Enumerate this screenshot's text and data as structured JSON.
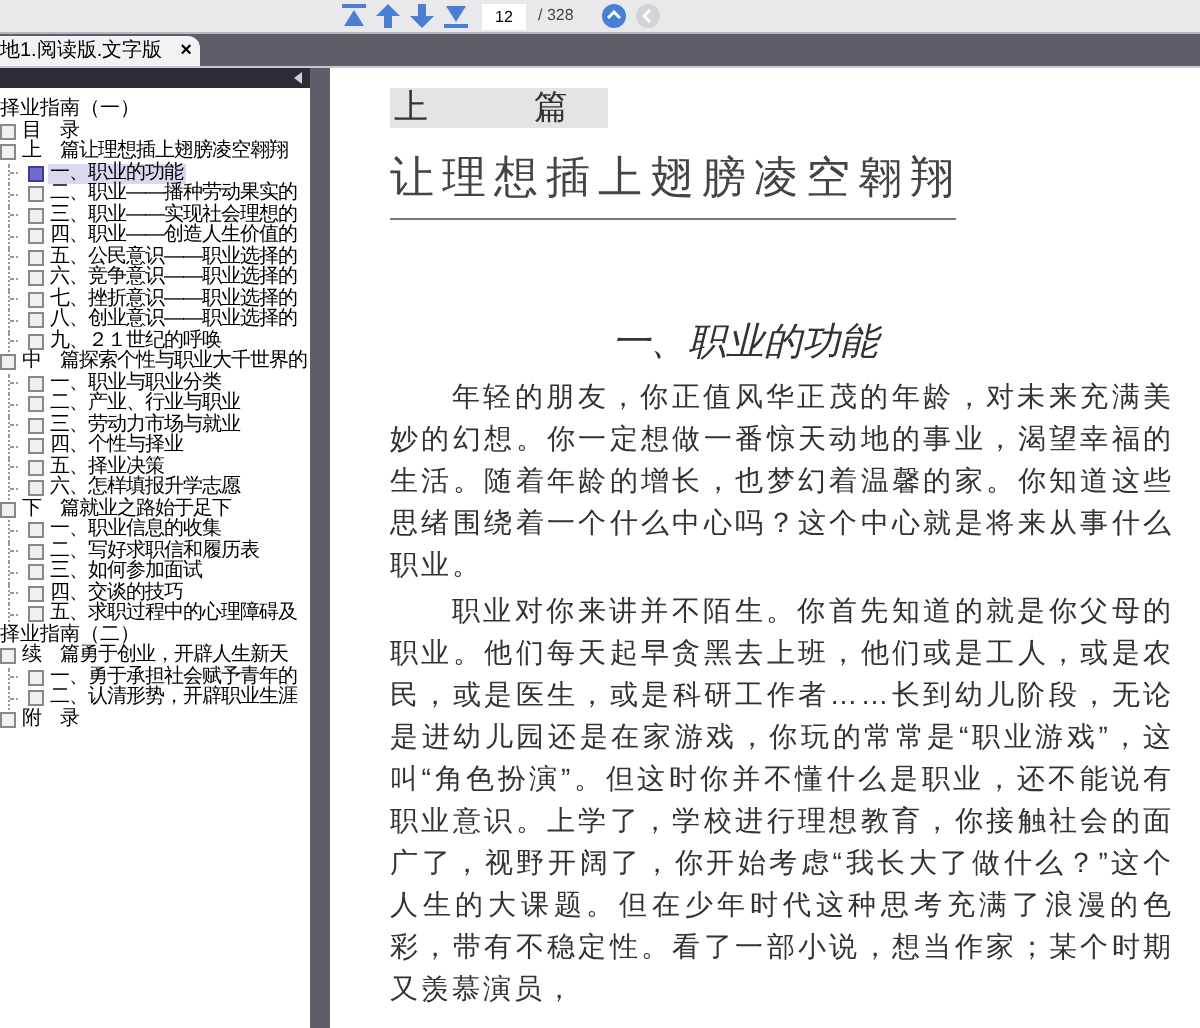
{
  "toolbar": {
    "page_number": "12",
    "page_total": "/ 328",
    "next_enabled": true,
    "prev_enabled": false
  },
  "tab": {
    "title": "地1.阅读版.文字版",
    "close": "×"
  },
  "outline": [
    {
      "label": "择业指南（一）",
      "kind": "heading"
    },
    {
      "label": "目　录",
      "kind": "item",
      "selected": false
    },
    {
      "label": "上　篇让理想插上翅膀凌空翱翔",
      "kind": "item",
      "selected": false,
      "children": [
        {
          "label": "一、职业的功能",
          "kind": "item",
          "selected": true
        },
        {
          "label": "二、职业——播种劳动果实的",
          "kind": "item",
          "selected": false
        },
        {
          "label": "三、职业——实现社会理想的",
          "kind": "item",
          "selected": false
        },
        {
          "label": "四、职业——创造人生价值的",
          "kind": "item",
          "selected": false
        },
        {
          "label": "五、公民意识——职业选择的",
          "kind": "item",
          "selected": false
        },
        {
          "label": "六、竞争意识——职业选择的",
          "kind": "item",
          "selected": false
        },
        {
          "label": "七、挫折意识——职业选择的",
          "kind": "item",
          "selected": false
        },
        {
          "label": "八、创业意识——职业选择的",
          "kind": "item",
          "selected": false
        },
        {
          "label": "九、２１世纪的呼唤",
          "kind": "item",
          "selected": false
        }
      ]
    },
    {
      "label": "中　篇探索个性与职业大千世界的",
      "kind": "item",
      "selected": false,
      "children": [
        {
          "label": "一、职业与职业分类",
          "kind": "item",
          "selected": false
        },
        {
          "label": "二、产业、行业与职业",
          "kind": "item",
          "selected": false
        },
        {
          "label": "三、劳动力市场与就业",
          "kind": "item",
          "selected": false
        },
        {
          "label": "四、个性与择业",
          "kind": "item",
          "selected": false
        },
        {
          "label": "五、择业决策",
          "kind": "item",
          "selected": false
        },
        {
          "label": "六、怎样填报升学志愿",
          "kind": "item",
          "selected": false
        }
      ]
    },
    {
      "label": "下　篇就业之路始于足下",
      "kind": "item",
      "selected": false,
      "children": [
        {
          "label": "一、职业信息的收集",
          "kind": "item",
          "selected": false
        },
        {
          "label": "二、写好求职信和履历表",
          "kind": "item",
          "selected": false
        },
        {
          "label": "三、如何参加面试",
          "kind": "item",
          "selected": false
        },
        {
          "label": "四、交谈的技巧",
          "kind": "item",
          "selected": false
        },
        {
          "label": "五、求职过程中的心理障碍及",
          "kind": "item",
          "selected": false
        }
      ]
    },
    {
      "label": "择业指南（二）",
      "kind": "heading"
    },
    {
      "label": "续　篇勇于创业，开辟人生新天",
      "kind": "item",
      "selected": false,
      "children": [
        {
          "label": "一、勇于承担社会赋予青年的",
          "kind": "item",
          "selected": false
        },
        {
          "label": "二、认清形势，开辟职业生涯",
          "kind": "item",
          "selected": false
        }
      ]
    },
    {
      "label": "附　录",
      "kind": "item",
      "selected": false
    }
  ],
  "page": {
    "part": "上　篇",
    "title": "让理想插上翅膀凌空翱翔",
    "section": "一、职业的功能",
    "paragraphs": [
      "年轻的朋友，你正值风华正茂的年龄，对未来充满美妙的幻想。你一定想做一番惊天动地的事业，渴望幸福的生活。随着年龄的增长，也梦幻着温馨的家。你知道这些思绪围绕着一个什么中心吗？这个中心就是将来从事什么职业。",
      "职业对你来讲并不陌生。你首先知道的就是你父母的职业。他们每天起早贪黑去上班，他们或是工人，或是农民，或是医生，或是科研工作者……长到幼儿阶段，无论是进幼儿园还是在家游戏，你玩的常常是“职业游戏”，这叫“角色扮演”。但这时你并不懂什么是职业，还不能说有职业意识。上学了，学校进行理想教育，你接触社会的面广了，视野开阔了，你开始考虑“我长大了做什么？”这个人生的大课题。但在少年时代这种思考充满了浪漫的色彩，带有不稳定性。看了一部小说，想当作家；某个时期又羡慕演员，"
    ]
  }
}
